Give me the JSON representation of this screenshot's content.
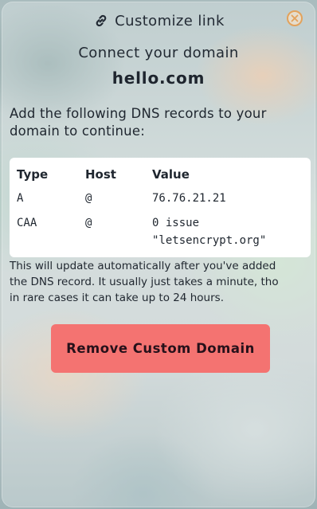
{
  "header": {
    "title": "Customize link",
    "link_icon": "link-icon",
    "close_icon": "close-icon",
    "close_color": "#e3a25b"
  },
  "subtitle": "Connect your domain",
  "domain": "hello.com",
  "instructions": "Add the following DNS records to your domain to continue:",
  "dns_table": {
    "headers": [
      "Type",
      "Host",
      "Value"
    ],
    "rows": [
      {
        "type": "A",
        "host": "@",
        "value_lines": [
          "76.76.21.21"
        ]
      },
      {
        "type": "CAA",
        "host": "@",
        "value_lines": [
          "0 issue",
          "\"letsencrypt.org\""
        ]
      }
    ]
  },
  "note_lines": [
    "This will update automatically after you've added",
    "the DNS record. It usually just takes a minute, tho",
    "in rare cases it can take up to 24 hours."
  ],
  "remove_button": {
    "label": "Remove Custom Domain",
    "color": "#f47371"
  }
}
